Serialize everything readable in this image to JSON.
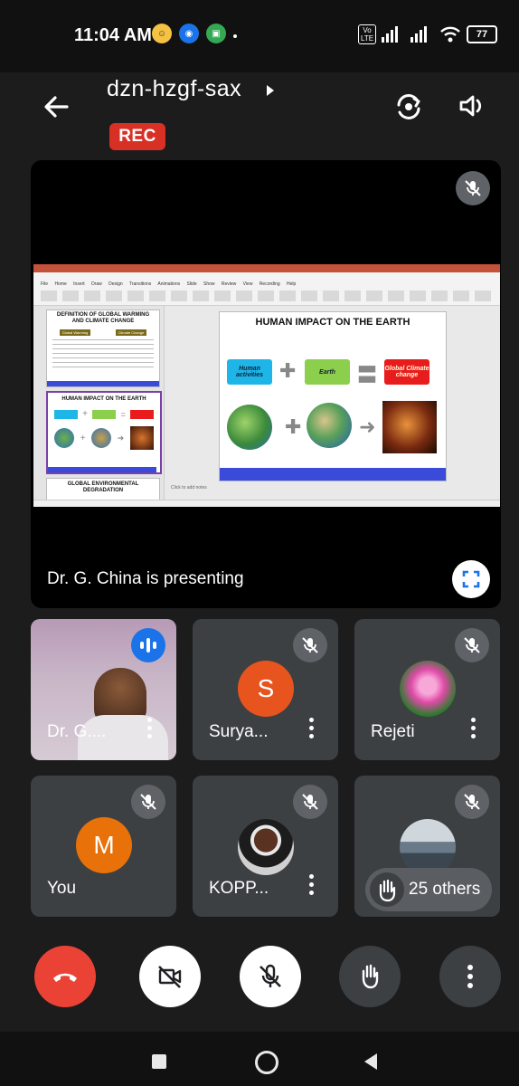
{
  "status_bar": {
    "time": "11:04 AM",
    "volte_label": "Vo LTE",
    "battery": "77"
  },
  "header": {
    "meeting_code": "dzn-hzgf-sax",
    "rec_label": "REC"
  },
  "stage": {
    "presenting_text": "Dr. G. China is presenting",
    "slide": {
      "main_title": "HUMAN IMPACT ON THE EARTH",
      "box_human": "Human activities",
      "box_earth": "Earth",
      "box_change": "Global Climate change",
      "thumb1_title": "DEFINITION OF GLOBAL WARMING AND CLIMATE CHANGE",
      "thumb1_col1": "Global Warming",
      "thumb1_col2": "Climate Change",
      "thumb2_title": "HUMAN IMPACT ON THE EARTH",
      "thumb3_title": "GLOBAL ENVIRONMENTAL DEGRADATION",
      "notes": "Click to add notes",
      "tabs": "File Home Insert Draw Design Transitions Animations Slide Show Review View Recording Help"
    }
  },
  "participants": [
    {
      "name": "Dr. G....",
      "kind": "video"
    },
    {
      "name": "Surya...",
      "kind": "letter",
      "letter": "S",
      "color": "#e8541e"
    },
    {
      "name": "Rejeti",
      "kind": "image"
    },
    {
      "name": "You",
      "kind": "letter",
      "letter": "M",
      "color": "#e8710a"
    },
    {
      "name": "KOPP...",
      "kind": "image"
    },
    {
      "name": "",
      "kind": "image"
    }
  ],
  "others_label": "25 others",
  "colors": {
    "rec": "#d93025",
    "end_call": "#ea4335",
    "speaking": "#1a73e8",
    "tile_bg": "#3c4043"
  }
}
